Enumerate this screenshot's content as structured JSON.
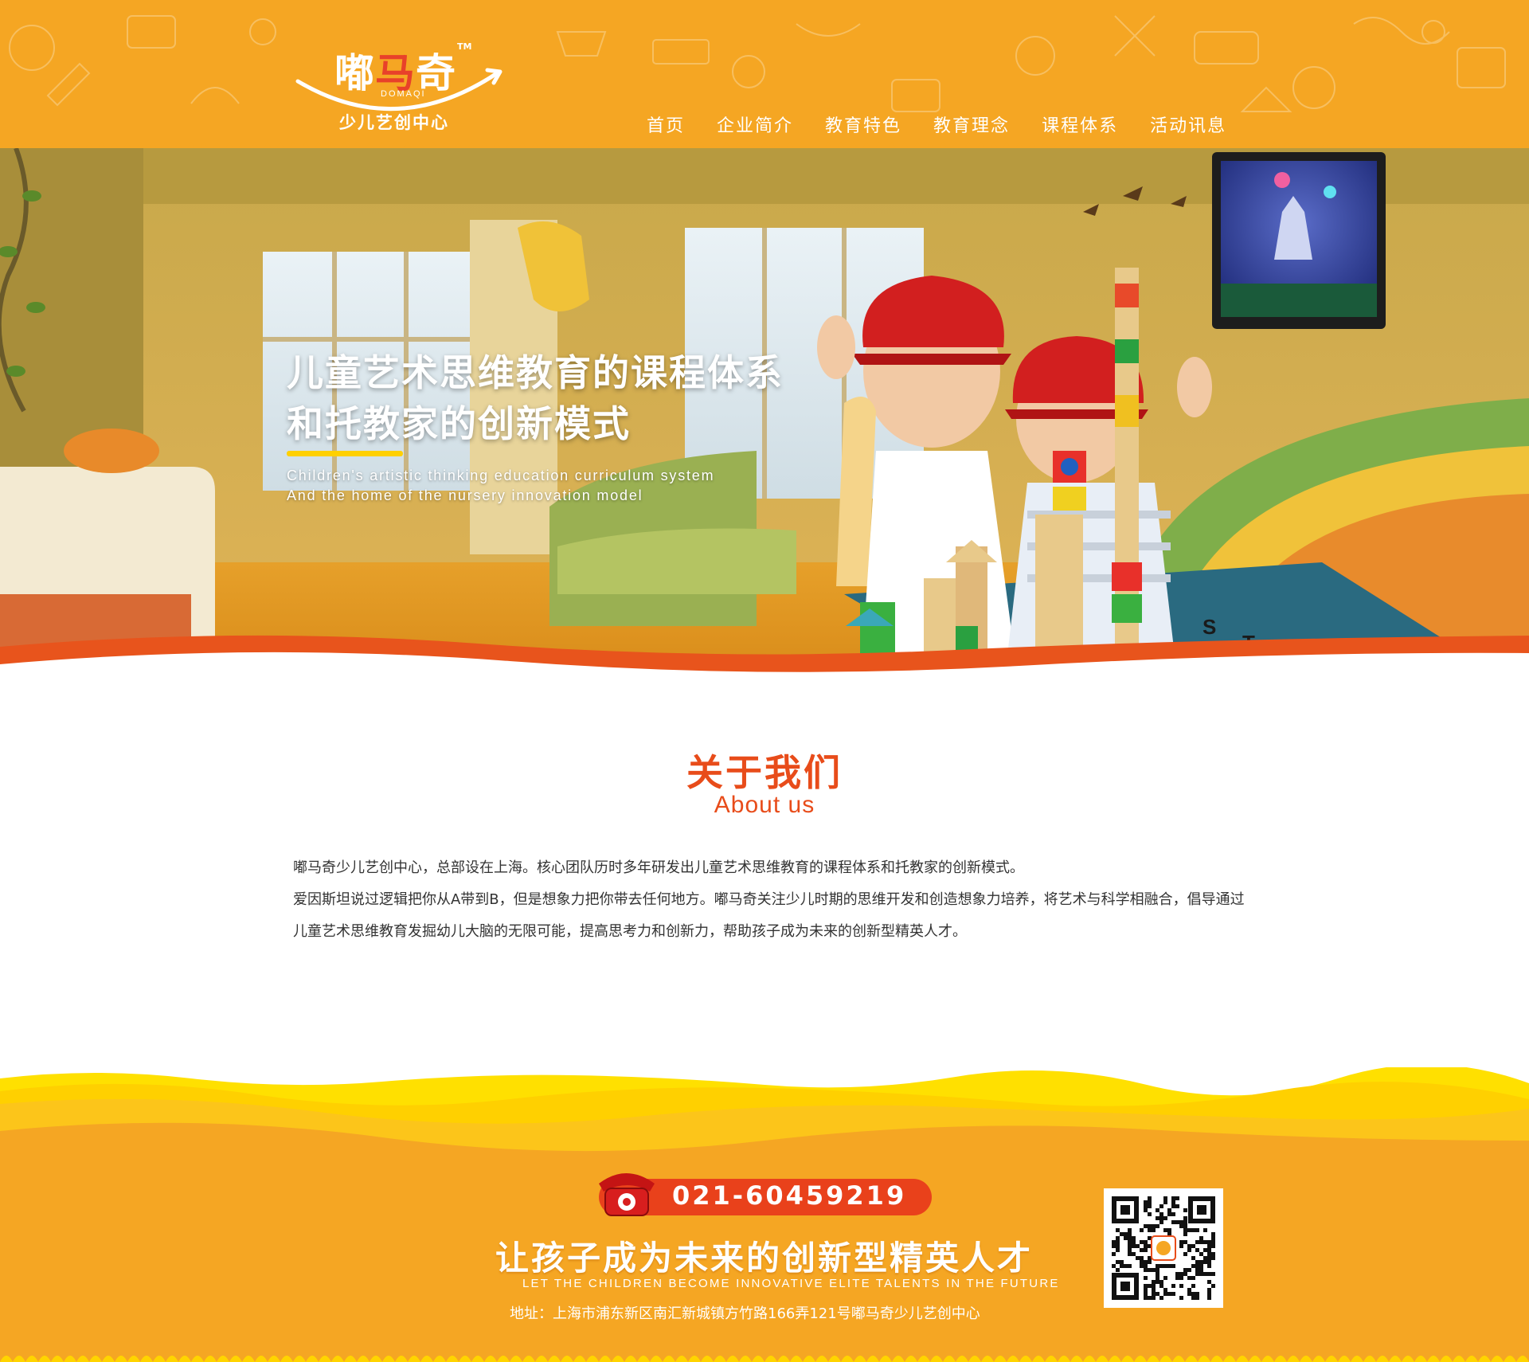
{
  "logo": {
    "name_part1": "嘟",
    "name_part2": "马",
    "name_part3": "奇",
    "tm": "TM",
    "pinyin": "DOMAQI",
    "subtitle": "少儿艺创中心"
  },
  "nav": {
    "items": [
      "首页",
      "企业简介",
      "教育特色",
      "教育理念",
      "课程体系",
      "活动讯息"
    ]
  },
  "hero": {
    "line1": "儿童艺术思维教育的课程体系",
    "line2": "和托教家的创新模式",
    "en_line1": "Children's artistic thinking education curriculum system",
    "en_line2": "And the home of the nursery innovation model"
  },
  "about": {
    "title": "关于我们",
    "subtitle": "About us",
    "paragraph1": "嘟马奇少儿艺创中心，总部设在上海。核心团队历时多年研发出儿童艺术思维教育的课程体系和托教家的创新模式。",
    "paragraph2": "爱因斯坦说过逻辑把你从A带到B，但是想象力把你带去任何地方。嘟马奇关注少儿时期的思维开发和创造想象力培养，将艺术与科学相融合，倡导通过儿童艺术思维教育发掘幼儿大脑的无限可能，提高思考力和创新力，帮助孩子成为未来的创新型精英人才。"
  },
  "footer": {
    "phone": "021-60459219",
    "slogan_cn": "让孩子成为未来的创新型精英人才",
    "slogan_en": "LET THE CHILDREN BECOME INNOVATIVE ELITE TALENTS IN THE FUTURE",
    "address": "地址：上海市浦东新区南汇新城镇方竹路166弄121号嘟马奇少儿艺创中心"
  },
  "colors": {
    "header_bg": "#f5a623",
    "accent_red": "#e84c1a",
    "footer_yellow": "#ffd700",
    "footer_orange": "#f5a623"
  }
}
